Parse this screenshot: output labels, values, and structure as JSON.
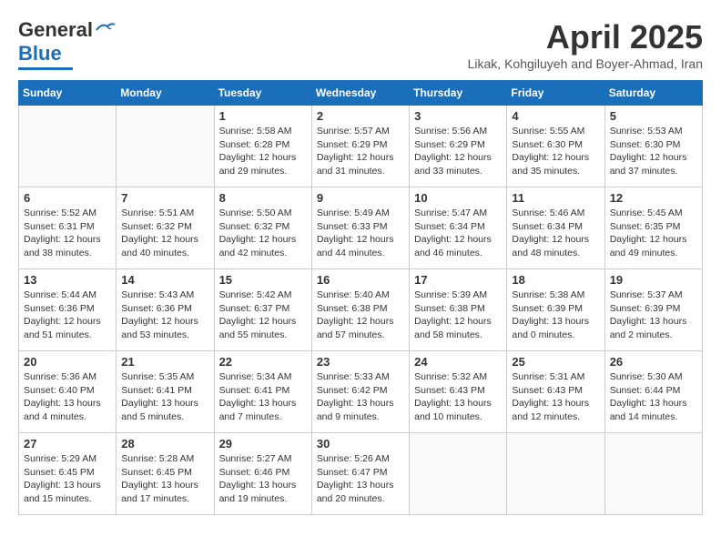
{
  "logo": {
    "line1": "General",
    "line2": "Blue"
  },
  "header": {
    "month": "April 2025",
    "subtitle": "Likak, Kohgiluyeh and Boyer-Ahmad, Iran"
  },
  "weekdays": [
    "Sunday",
    "Monday",
    "Tuesday",
    "Wednesday",
    "Thursday",
    "Friday",
    "Saturday"
  ],
  "weeks": [
    [
      {
        "day": "",
        "info": ""
      },
      {
        "day": "",
        "info": ""
      },
      {
        "day": "1",
        "info": "Sunrise: 5:58 AM\nSunset: 6:28 PM\nDaylight: 12 hours\nand 29 minutes."
      },
      {
        "day": "2",
        "info": "Sunrise: 5:57 AM\nSunset: 6:29 PM\nDaylight: 12 hours\nand 31 minutes."
      },
      {
        "day": "3",
        "info": "Sunrise: 5:56 AM\nSunset: 6:29 PM\nDaylight: 12 hours\nand 33 minutes."
      },
      {
        "day": "4",
        "info": "Sunrise: 5:55 AM\nSunset: 6:30 PM\nDaylight: 12 hours\nand 35 minutes."
      },
      {
        "day": "5",
        "info": "Sunrise: 5:53 AM\nSunset: 6:30 PM\nDaylight: 12 hours\nand 37 minutes."
      }
    ],
    [
      {
        "day": "6",
        "info": "Sunrise: 5:52 AM\nSunset: 6:31 PM\nDaylight: 12 hours\nand 38 minutes."
      },
      {
        "day": "7",
        "info": "Sunrise: 5:51 AM\nSunset: 6:32 PM\nDaylight: 12 hours\nand 40 minutes."
      },
      {
        "day": "8",
        "info": "Sunrise: 5:50 AM\nSunset: 6:32 PM\nDaylight: 12 hours\nand 42 minutes."
      },
      {
        "day": "9",
        "info": "Sunrise: 5:49 AM\nSunset: 6:33 PM\nDaylight: 12 hours\nand 44 minutes."
      },
      {
        "day": "10",
        "info": "Sunrise: 5:47 AM\nSunset: 6:34 PM\nDaylight: 12 hours\nand 46 minutes."
      },
      {
        "day": "11",
        "info": "Sunrise: 5:46 AM\nSunset: 6:34 PM\nDaylight: 12 hours\nand 48 minutes."
      },
      {
        "day": "12",
        "info": "Sunrise: 5:45 AM\nSunset: 6:35 PM\nDaylight: 12 hours\nand 49 minutes."
      }
    ],
    [
      {
        "day": "13",
        "info": "Sunrise: 5:44 AM\nSunset: 6:36 PM\nDaylight: 12 hours\nand 51 minutes."
      },
      {
        "day": "14",
        "info": "Sunrise: 5:43 AM\nSunset: 6:36 PM\nDaylight: 12 hours\nand 53 minutes."
      },
      {
        "day": "15",
        "info": "Sunrise: 5:42 AM\nSunset: 6:37 PM\nDaylight: 12 hours\nand 55 minutes."
      },
      {
        "day": "16",
        "info": "Sunrise: 5:40 AM\nSunset: 6:38 PM\nDaylight: 12 hours\nand 57 minutes."
      },
      {
        "day": "17",
        "info": "Sunrise: 5:39 AM\nSunset: 6:38 PM\nDaylight: 12 hours\nand 58 minutes."
      },
      {
        "day": "18",
        "info": "Sunrise: 5:38 AM\nSunset: 6:39 PM\nDaylight: 13 hours\nand 0 minutes."
      },
      {
        "day": "19",
        "info": "Sunrise: 5:37 AM\nSunset: 6:39 PM\nDaylight: 13 hours\nand 2 minutes."
      }
    ],
    [
      {
        "day": "20",
        "info": "Sunrise: 5:36 AM\nSunset: 6:40 PM\nDaylight: 13 hours\nand 4 minutes."
      },
      {
        "day": "21",
        "info": "Sunrise: 5:35 AM\nSunset: 6:41 PM\nDaylight: 13 hours\nand 5 minutes."
      },
      {
        "day": "22",
        "info": "Sunrise: 5:34 AM\nSunset: 6:41 PM\nDaylight: 13 hours\nand 7 minutes."
      },
      {
        "day": "23",
        "info": "Sunrise: 5:33 AM\nSunset: 6:42 PM\nDaylight: 13 hours\nand 9 minutes."
      },
      {
        "day": "24",
        "info": "Sunrise: 5:32 AM\nSunset: 6:43 PM\nDaylight: 13 hours\nand 10 minutes."
      },
      {
        "day": "25",
        "info": "Sunrise: 5:31 AM\nSunset: 6:43 PM\nDaylight: 13 hours\nand 12 minutes."
      },
      {
        "day": "26",
        "info": "Sunrise: 5:30 AM\nSunset: 6:44 PM\nDaylight: 13 hours\nand 14 minutes."
      }
    ],
    [
      {
        "day": "27",
        "info": "Sunrise: 5:29 AM\nSunset: 6:45 PM\nDaylight: 13 hours\nand 15 minutes."
      },
      {
        "day": "28",
        "info": "Sunrise: 5:28 AM\nSunset: 6:45 PM\nDaylight: 13 hours\nand 17 minutes."
      },
      {
        "day": "29",
        "info": "Sunrise: 5:27 AM\nSunset: 6:46 PM\nDaylight: 13 hours\nand 19 minutes."
      },
      {
        "day": "30",
        "info": "Sunrise: 5:26 AM\nSunset: 6:47 PM\nDaylight: 13 hours\nand 20 minutes."
      },
      {
        "day": "",
        "info": ""
      },
      {
        "day": "",
        "info": ""
      },
      {
        "day": "",
        "info": ""
      }
    ]
  ]
}
